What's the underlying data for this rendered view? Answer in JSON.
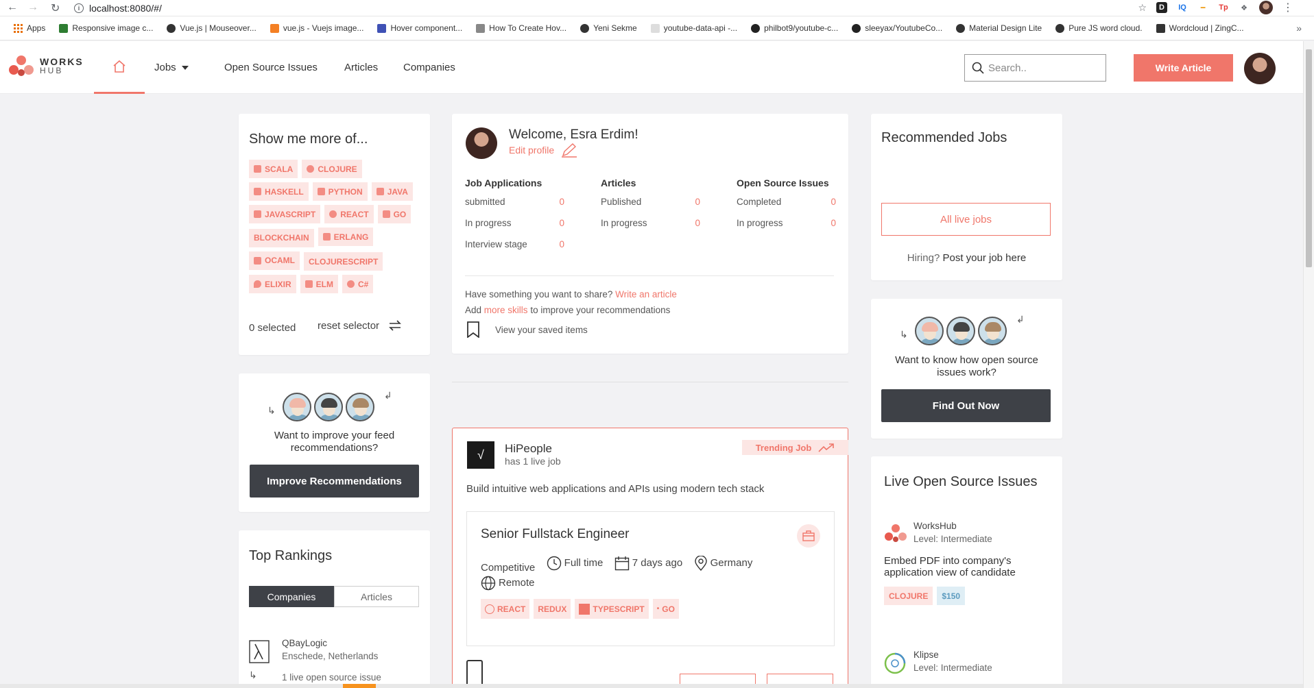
{
  "browser": {
    "url": "localhost:8080/#/",
    "bookmarks": [
      {
        "label": "Apps",
        "color": "#e8710a"
      },
      {
        "label": "Responsive image c...",
        "color": "#2e7d32"
      },
      {
        "label": "Vue.js | Mouseover...",
        "color": "#333333"
      },
      {
        "label": "vue.js - Vuejs image...",
        "color": "#f48024"
      },
      {
        "label": "Hover component...",
        "color": "#3f51b5"
      },
      {
        "label": "How To Create Hov...",
        "color": "#888888"
      },
      {
        "label": "Yeni Sekme",
        "color": "#333333"
      },
      {
        "label": "youtube-data-api -...",
        "color": "#dddddd"
      },
      {
        "label": "philbot9/youtube-c...",
        "color": "#222222"
      },
      {
        "label": "sleeyax/YoutubeCo...",
        "color": "#222222"
      },
      {
        "label": "Material Design Lite",
        "color": "#333333"
      },
      {
        "label": "Pure JS word cloud.",
        "color": "#333333"
      },
      {
        "label": "Wordcloud | ZingC...",
        "color": "#333333"
      }
    ],
    "more": "»"
  },
  "header": {
    "logo_top": "WORKS",
    "logo_bottom": "HUB",
    "nav": {
      "jobs": "Jobs",
      "open_source": "Open Source Issues",
      "articles": "Articles",
      "companies": "Companies"
    },
    "search_placeholder": "Search..",
    "write_article": "Write Article"
  },
  "show_more": {
    "title": "Show me more of...",
    "tags": [
      [
        "SCALA",
        "CLOJURE"
      ],
      [
        "HASKELL",
        "PYTHON",
        "JAVA"
      ],
      [
        "JAVASCRIPT",
        "REACT",
        "GO"
      ],
      [
        "BLOCKCHAIN",
        "ERLANG"
      ],
      [
        "OCAML",
        "CLOJURESCRIPT"
      ],
      [
        "ELIXIR",
        "ELM",
        "C#"
      ]
    ],
    "selected": "0 selected",
    "reset": "reset selector"
  },
  "improve": {
    "text": "Want to improve your feed recommendations?",
    "button": "Improve Recommendations"
  },
  "rankings": {
    "title": "Top Rankings",
    "tab_companies": "Companies",
    "tab_articles": "Articles",
    "first": {
      "name": "QBayLogic",
      "location": "Enschede, Netherlands",
      "issues": "1 live open source issue"
    }
  },
  "welcome": {
    "greeting": "Welcome, Esra Erdim!",
    "edit_profile": "Edit profile",
    "job_applications": {
      "head": "Job Applications",
      "rows": [
        {
          "label": "submitted",
          "value": "0"
        },
        {
          "label": "In progress",
          "value": "0"
        },
        {
          "label": "Interview stage",
          "value": "0"
        }
      ]
    },
    "articles": {
      "head": "Articles",
      "rows": [
        {
          "label": "Published",
          "value": "0"
        },
        {
          "label": "In progress",
          "value": "0"
        }
      ]
    },
    "open_source": {
      "head": "Open Source Issues",
      "rows": [
        {
          "label": "Completed",
          "value": "0"
        },
        {
          "label": "In progress",
          "value": "0"
        }
      ]
    },
    "share_prefix": "Have something you want to share?",
    "share_link": "Write an article",
    "skills_prefix": "Add",
    "skills_link": "more skills",
    "skills_suffix": "to improve your recommendations",
    "saved": "View your saved items"
  },
  "job_card": {
    "company": "HiPeople",
    "live": "has 1 live job",
    "trending": "Trending Job",
    "description": "Build intuitive web applications and APIs using modern tech stack",
    "title": "Senior Fullstack Engineer",
    "salary": "Competitive",
    "type": "Full time",
    "posted": "7 days ago",
    "location": "Germany",
    "remote": "Remote",
    "tags": [
      "REACT",
      "REDUX",
      "TYPESCRIPT",
      "GO"
    ]
  },
  "recommended": {
    "title": "Recommended Jobs",
    "all_jobs": "All live jobs",
    "hiring": "Hiring?",
    "post_job": "Post your job here"
  },
  "os_info": {
    "text": "Want to know how open source issues work?",
    "button": "Find Out Now"
  },
  "live_issues": {
    "title": "Live Open Source Issues",
    "items": [
      {
        "company": "WorksHub",
        "level": "Level: Intermediate",
        "title": "Embed PDF into company's application view of candidate",
        "tags": [
          "CLOJURE",
          "$150"
        ]
      },
      {
        "company": "Klipse",
        "level": "Level: Intermediate"
      }
    ]
  },
  "colors": {
    "accent": "#f0766a",
    "dark_button": "#3e4147",
    "tag_bg": "#fce6e4"
  }
}
